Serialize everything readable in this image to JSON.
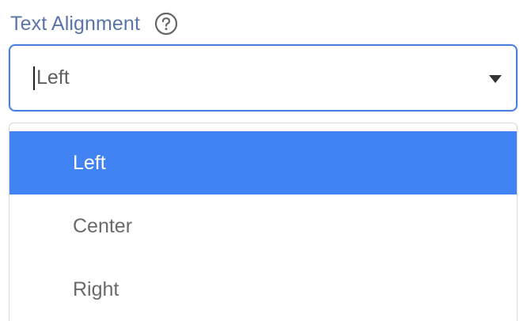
{
  "field": {
    "label": "Text Alignment",
    "help_icon": "question-circle-icon",
    "value": "Left",
    "dropdown_icon": "caret-down-icon"
  },
  "menu": {
    "options": [
      {
        "label": "Left",
        "selected": true
      },
      {
        "label": "Center",
        "selected": false
      },
      {
        "label": "Right",
        "selected": false
      }
    ]
  },
  "colors": {
    "label": "#5a75a8",
    "focus_border": "#4a7fe0",
    "selected_bg": "#4283f4",
    "option_text": "#6a6a6a"
  }
}
